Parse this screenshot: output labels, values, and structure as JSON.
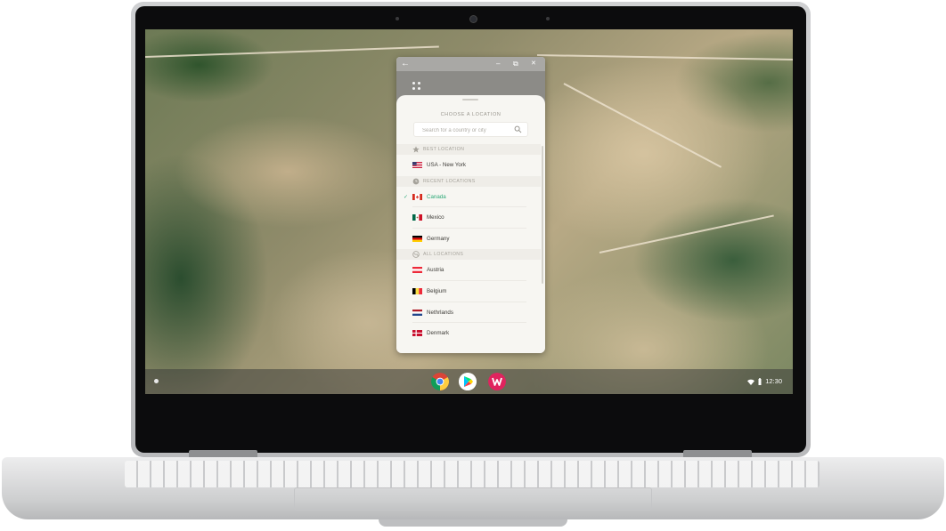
{
  "window": {
    "back_glyph": "←",
    "minimize_glyph": "–",
    "restore_glyph": "⧉",
    "close_glyph": "✕"
  },
  "location_picker": {
    "title": "CHOOSE A LOCATION",
    "search": {
      "placeholder": "Search for a country or city",
      "value": ""
    },
    "sections": {
      "best": "BEST LOCATION",
      "recent": "RECENT LOCATIONS",
      "all": "ALL LOCATIONS"
    },
    "best": [
      {
        "name": "USA - New York",
        "flag": "us"
      }
    ],
    "recent": [
      {
        "name": "Canada",
        "flag": "ca",
        "selected": true
      },
      {
        "name": "Mexico",
        "flag": "mx"
      },
      {
        "name": "Germany",
        "flag": "de"
      }
    ],
    "all": [
      {
        "name": "Austria",
        "flag": "at"
      },
      {
        "name": "Belgium",
        "flag": "be"
      },
      {
        "name": "Nethrlands",
        "flag": "nl"
      },
      {
        "name": "Denmark",
        "flag": "dk"
      }
    ],
    "selected_check": "✓",
    "accent_color": "#2aa876"
  },
  "shelf": {
    "apps": [
      "chrome-icon",
      "play-store-icon",
      "windscribe-icon"
    ],
    "clock": "12:30"
  }
}
